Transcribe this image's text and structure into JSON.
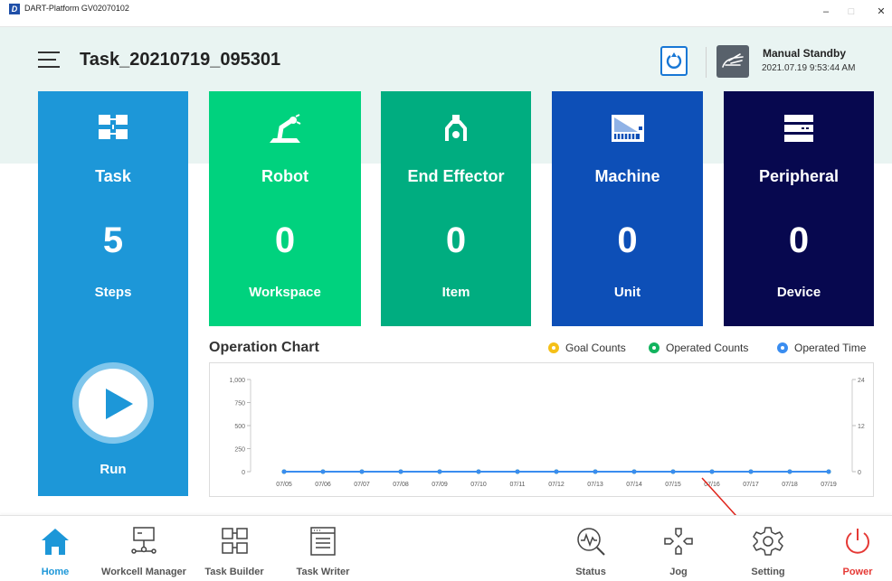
{
  "window": {
    "title": "DART-Platform GV02070102",
    "logo_letter": "D",
    "minimize": "–",
    "maximize": "□",
    "close": "✕"
  },
  "header": {
    "task_name": "Task_20210719_095301",
    "status_title": "Manual Standby",
    "status_time": "2021.07.19 9:53:44 AM"
  },
  "cards": {
    "task": {
      "label": "Task",
      "count": "5",
      "unit": "Steps",
      "run_label": "Run"
    },
    "robot": {
      "label": "Robot",
      "count": "0",
      "unit": "Workspace"
    },
    "end_effector": {
      "label": "End Effector",
      "count": "0",
      "unit": "Item"
    },
    "machine": {
      "label": "Machine",
      "count": "0",
      "unit": "Unit"
    },
    "peripheral": {
      "label": "Peripheral",
      "count": "0",
      "unit": "Device"
    }
  },
  "colors": {
    "task": "#1d97d8",
    "robot": "#00d27e",
    "end_effector": "#00ad80",
    "machine": "#0d4fb7",
    "peripheral": "#07084f",
    "goal": "#f5c018",
    "operated_counts": "#12b35e",
    "operated_time": "#3a8df0"
  },
  "operation_chart": {
    "title": "Operation Chart",
    "legend": {
      "goal": "Goal Counts",
      "operated_counts": "Operated Counts",
      "operated_time": "Operated Time"
    }
  },
  "chart_data": {
    "type": "line",
    "categories": [
      "07/05",
      "07/06",
      "07/07",
      "07/08",
      "07/09",
      "07/10",
      "07/11",
      "07/12",
      "07/13",
      "07/14",
      "07/15",
      "07/16",
      "07/17",
      "07/18",
      "07/19"
    ],
    "series": [
      {
        "name": "Goal Counts",
        "values": [
          0,
          0,
          0,
          0,
          0,
          0,
          0,
          0,
          0,
          0,
          0,
          0,
          0,
          0,
          0
        ]
      },
      {
        "name": "Operated Counts",
        "values": [
          0,
          0,
          0,
          0,
          0,
          0,
          0,
          0,
          0,
          0,
          0,
          0,
          0,
          0,
          0
        ]
      },
      {
        "name": "Operated Time",
        "values": [
          0,
          0,
          0,
          0,
          0,
          0,
          0,
          0,
          0,
          0,
          0,
          0,
          0,
          0,
          0
        ]
      }
    ],
    "y_left_ticks": [
      "0",
      "250",
      "500",
      "750",
      "1,000"
    ],
    "y_left_values": [
      0,
      250,
      500,
      750,
      1000
    ],
    "y_right_ticks": [
      "0",
      "12",
      "24"
    ],
    "y_right_values": [
      0,
      12,
      24
    ],
    "ylim_left": [
      0,
      1000
    ],
    "ylim_right": [
      0,
      24
    ],
    "grid": false
  },
  "nav": [
    {
      "label": "Home",
      "icon": "home-icon"
    },
    {
      "label": "Workcell Manager",
      "icon": "workcell-icon"
    },
    {
      "label": "Task Builder",
      "icon": "task-builder-icon"
    },
    {
      "label": "Task Writer",
      "icon": "task-writer-icon"
    },
    {
      "label": "Status",
      "icon": "status-icon"
    },
    {
      "label": "Jog",
      "icon": "jog-icon"
    },
    {
      "label": "Setting",
      "icon": "gear-icon"
    },
    {
      "label": "Power",
      "icon": "power-icon"
    }
  ]
}
